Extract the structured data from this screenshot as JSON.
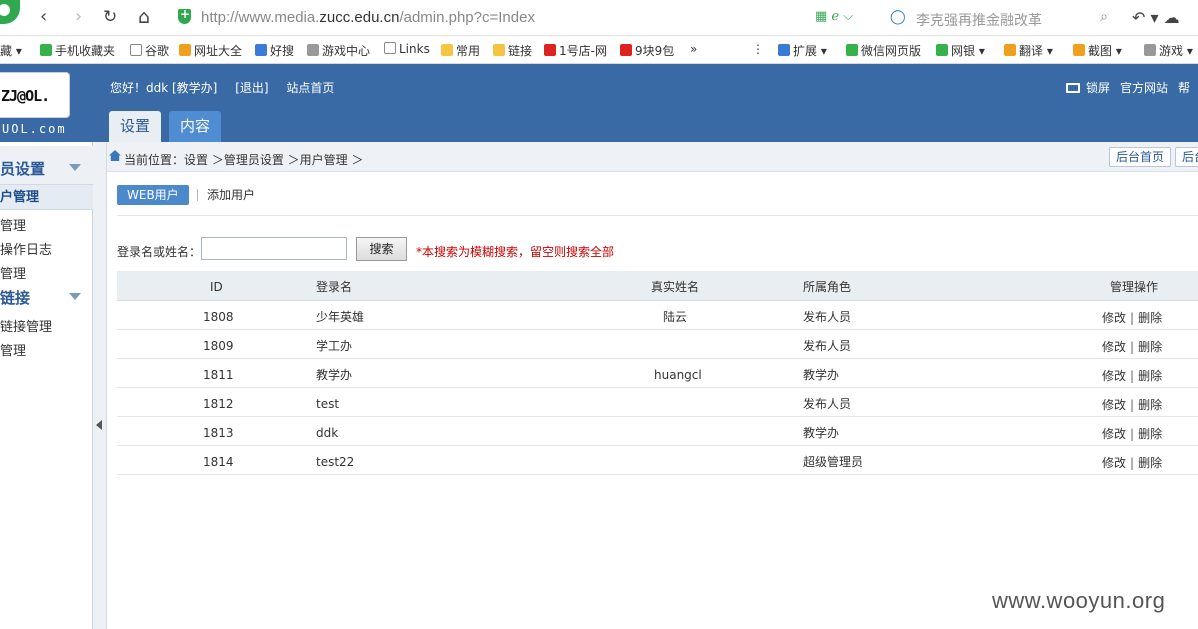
{
  "browser": {
    "url_prefix": "http://www.media.",
    "url_host": "zucc.edu.cn",
    "url_suffix": "/admin.php?c=Index",
    "search_placeholder": "李克强再推金融改革",
    "nav_back": "‹",
    "nav_forward": "›",
    "nav_reload": "↻",
    "nav_home": "⌂",
    "addr_icons": "▦ ℯ ⌵",
    "addr_right_icons": "↶ ▾ ☁"
  },
  "bookmarks": [
    {
      "label": "藏 ▾",
      "icon": "none"
    },
    {
      "label": "手机收藏夹",
      "icon": "green"
    },
    {
      "label": "谷歌",
      "icon": "page"
    },
    {
      "label": "网址大全",
      "icon": "orange"
    },
    {
      "label": "好搜",
      "icon": "blue"
    },
    {
      "label": "游戏中心",
      "icon": "gray"
    },
    {
      "label": "Links",
      "icon": "page"
    },
    {
      "label": "常用",
      "icon": "folder"
    },
    {
      "label": "链接",
      "icon": "folder"
    },
    {
      "label": "1号店-网",
      "icon": "red"
    },
    {
      "label": "9块9包",
      "icon": "red"
    },
    {
      "label": "»",
      "icon": "none"
    },
    {
      "label": "⋮",
      "icon": "none"
    },
    {
      "label": "扩展 ▾",
      "icon": "blue"
    },
    {
      "label": "微信网页版",
      "icon": "green"
    },
    {
      "label": "网银 ▾",
      "icon": "green"
    },
    {
      "label": "翻译 ▾",
      "icon": "orange"
    },
    {
      "label": "截图 ▾",
      "icon": "orange"
    },
    {
      "label": "游戏 ▾",
      "icon": "gray"
    }
  ],
  "header": {
    "logo_text": "ZJ@OL.",
    "logo_sub": "UOL.com",
    "greeting": "您好！ddk [教学办]",
    "logout": "[退出]",
    "site_home": "站点首页",
    "tabs": [
      {
        "label": "设置",
        "active": true
      },
      {
        "label": "内容",
        "active": false
      }
    ],
    "right_links": [
      "锁屏",
      "官方网站",
      "帮"
    ]
  },
  "sidebar": {
    "sections": [
      {
        "title": "员设置",
        "items": [
          "户管理",
          "管理",
          "操作日志",
          "管理"
        ]
      },
      {
        "title": "链接",
        "items": [
          "链接管理",
          "管理"
        ]
      }
    ]
  },
  "breadcrumb": {
    "text": "当前位置：设置 ＞管理员设置 ＞用户管理 ＞",
    "buttons": [
      "后台首页",
      "后台"
    ]
  },
  "subnav": {
    "active": "WEB用户",
    "link": "添加用户"
  },
  "search": {
    "label": "登录名或姓名：",
    "value": "",
    "button": "搜索",
    "hint": "*本搜索为模糊搜索，留空则搜索全部"
  },
  "table": {
    "columns": [
      "ID",
      "登录名",
      "真实姓名",
      "所属角色",
      "管理操作"
    ],
    "rows": [
      {
        "id": "1808",
        "login": "少年英雄",
        "name": "陆云",
        "role": "发布人员"
      },
      {
        "id": "1809",
        "login": "学工办",
        "name": "",
        "role": "发布人员"
      },
      {
        "id": "1811",
        "login": "教学办",
        "name": "huangcl",
        "role": "教学办"
      },
      {
        "id": "1812",
        "login": "test",
        "name": "",
        "role": "发布人员"
      },
      {
        "id": "1813",
        "login": "ddk",
        "name": "",
        "role": "教学办"
      },
      {
        "id": "1814",
        "login": "test22",
        "name": "",
        "role": "超级管理员"
      }
    ],
    "edit_label": "修改",
    "op_separator": "|",
    "delete_label": "删除"
  },
  "watermark": "www.wooyun.org",
  "colors": {
    "header_blue": "#3a6aa5",
    "active_button_blue": "#4c88cc",
    "hint_red": "#cc0000"
  }
}
